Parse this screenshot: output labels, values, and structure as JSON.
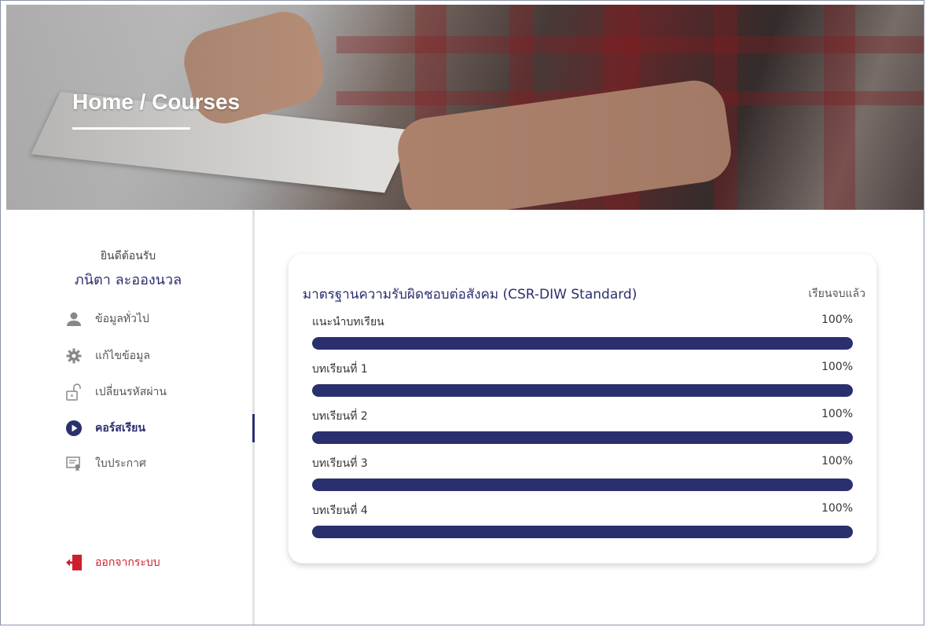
{
  "hero": {
    "title": "Home / Courses"
  },
  "sidebar": {
    "welcome": "ยินดีต้อนรับ",
    "username": "ภนิตา  ละอองนวล",
    "items": [
      {
        "label": "ข้อมูลทั่วไป",
        "icon": "user-icon"
      },
      {
        "label": "แก้ไขข้อมูล",
        "icon": "gear-icon"
      },
      {
        "label": "เปลี่ยนรหัสผ่าน",
        "icon": "unlock-icon"
      },
      {
        "label": "คอร์สเรียน",
        "icon": "play-circle-icon",
        "active": true
      },
      {
        "label": "ใบประกาศ",
        "icon": "certificate-icon"
      }
    ],
    "logout": {
      "label": "ออกจากระบบ",
      "icon": "exit-icon"
    }
  },
  "course": {
    "title": "มาตรฐานความรับผิดชอบต่อสังคม (CSR-DIW Standard)",
    "status": "เรียนจบแล้ว",
    "lessons": [
      {
        "name": "แนะนำบทเรียน",
        "percent_label": "100%",
        "progress": 100
      },
      {
        "name": "บทเรียนที่ 1",
        "percent_label": "100%",
        "progress": 100
      },
      {
        "name": "บทเรียนที่ 2",
        "percent_label": "100%",
        "progress": 100
      },
      {
        "name": "บทเรียนที่ 3",
        "percent_label": "100%",
        "progress": 100
      },
      {
        "name": "บทเรียนที่ 4",
        "percent_label": "100%",
        "progress": 100
      }
    ]
  },
  "colors": {
    "accent": "#2a2f6e",
    "logout": "#cc1f2c",
    "bar_track": "#e4e5ef"
  }
}
